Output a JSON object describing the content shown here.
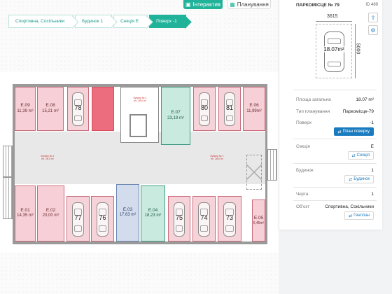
{
  "toolbar": {
    "interactive_label": "Інтерактив",
    "planning_label": "Планування"
  },
  "breadcrumb": [
    {
      "label": "Спортивна, Сосільники"
    },
    {
      "label": "Будинок 1"
    },
    {
      "label": "Секція Е"
    },
    {
      "label": "Поверх -1"
    }
  ],
  "plan": {
    "parking": [
      "78",
      "80",
      "81",
      "77",
      "76",
      "75",
      "74",
      "73"
    ],
    "storage": [
      {
        "code": "E.09",
        "area": "11,39 m²"
      },
      {
        "code": "E.08",
        "area": "15,21 m²"
      },
      {
        "code": "E.07",
        "area": "23,19 m²"
      },
      {
        "code": "E.06",
        "area": "11,99m²"
      },
      {
        "code": "E.01",
        "area": "14,35 m²"
      },
      {
        "code": "E.02",
        "area": "20,00 m²"
      },
      {
        "code": "E.03",
        "area": "17,63 m²"
      },
      {
        "code": "E.04",
        "area": "18,23 m²"
      },
      {
        "code": "E.05",
        "area": "6,45m²"
      }
    ]
  },
  "panel": {
    "title": "ПАРКОМІСЦЕ № 79",
    "id_label": "ID 489",
    "dim_width": "3615",
    "dim_length": "5000",
    "area_label": "18.07m²",
    "rows": [
      {
        "label": "Площа загальна",
        "value": "18.07 m²"
      },
      {
        "label": "Тип планування",
        "value": "Паркомісце-79"
      },
      {
        "label": "Поверх",
        "value": "-1"
      },
      {
        "label": "Секція",
        "value": "Е"
      },
      {
        "label": "Будинок",
        "value": "1"
      },
      {
        "label": "Черга",
        "value": "1"
      },
      {
        "label": "Об'єкт",
        "value": "Спортивна, Сокільники"
      }
    ],
    "buttons": {
      "floor_plan": "План поверху",
      "section": "Секція",
      "building": "Будинок",
      "master_plan": "Генплан"
    }
  },
  "colors": {
    "accent": "#20b39a",
    "link": "#1a7bbf",
    "sold": "#f6d0d6",
    "selected": "#ec6e7e"
  }
}
